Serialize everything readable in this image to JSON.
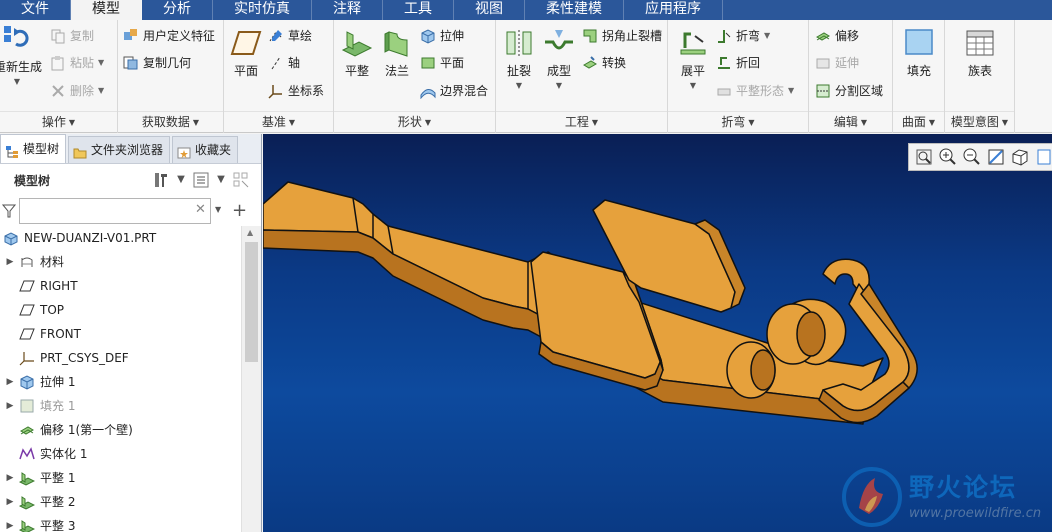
{
  "menu": {
    "tabs": [
      "文件",
      "模型",
      "分析",
      "实时仿真",
      "注释",
      "工具",
      "视图",
      "柔性建模",
      "应用程序"
    ],
    "active": "模型"
  },
  "ribbon": {
    "operations": {
      "regen_label": "重新生成",
      "copy_label": "复制",
      "paste_label": "粘贴",
      "delete_label": "删除",
      "title": "操作"
    },
    "get_data": {
      "udf_label": "用户定义特征",
      "copy_geom_label": "复制几何",
      "title": "获取数据"
    },
    "datum": {
      "plane_label": "平面",
      "sketch_label": "草绘",
      "axis_label": "轴",
      "csys_label": "坐标系",
      "title": "基准"
    },
    "shapes": {
      "flat_label": "平整",
      "flange_label": "法兰",
      "extrude_label": "拉伸",
      "plane_label": "平面",
      "blend_label": "边界混合",
      "title": "形状"
    },
    "engineering": {
      "rip_label": "扯裂",
      "form_label": "成型",
      "corner_relief_label": "拐角止裂槽",
      "convert_label": "转换",
      "title": "工程"
    },
    "bend": {
      "unbend_label": "展平",
      "bend_label": "折弯",
      "bend_back_label": "折回",
      "flat_state_label": "平整形态",
      "title": "折弯"
    },
    "edit": {
      "offset_label": "偏移",
      "extend_label": "延伸",
      "split_label": "分割区域",
      "title": "编辑"
    },
    "surface": {
      "fill_label": "填充",
      "title": "曲面"
    },
    "intent": {
      "family_label": "族表",
      "title": "模型意图"
    }
  },
  "panel": {
    "tabs": [
      "模型树",
      "文件夹浏览器",
      "收藏夹"
    ],
    "active_tab": "模型树",
    "title": "模型树",
    "search": {
      "value": "",
      "placeholder": ""
    },
    "tree": [
      {
        "label": "NEW-DUANZI-V01.PRT",
        "icon": "part-icon",
        "expandable": false,
        "dim": false
      },
      {
        "label": "材料",
        "icon": "material-icon",
        "expandable": true,
        "dim": false
      },
      {
        "label": "RIGHT",
        "icon": "datum-plane-icon",
        "expandable": false,
        "dim": false
      },
      {
        "label": "TOP",
        "icon": "datum-plane-icon",
        "expandable": false,
        "dim": false
      },
      {
        "label": "FRONT",
        "icon": "datum-plane-icon",
        "expandable": false,
        "dim": false
      },
      {
        "label": "PRT_CSYS_DEF",
        "icon": "csys-icon",
        "expandable": false,
        "dim": false
      },
      {
        "label": "拉伸 1",
        "icon": "extrude-icon",
        "expandable": true,
        "dim": false
      },
      {
        "label": "填充 1",
        "icon": "fill-icon",
        "expandable": true,
        "dim": true
      },
      {
        "label": "偏移 1(第一个壁)",
        "icon": "offset-icon",
        "expandable": false,
        "dim": false
      },
      {
        "label": "实体化 1",
        "icon": "solidify-icon",
        "expandable": false,
        "dim": false
      },
      {
        "label": "平整 1",
        "icon": "flat-wall-icon",
        "expandable": true,
        "dim": false
      },
      {
        "label": "平整 2",
        "icon": "flat-wall-icon",
        "expandable": true,
        "dim": false
      },
      {
        "label": "平整 3",
        "icon": "flat-wall-icon",
        "expandable": true,
        "dim": false
      }
    ]
  },
  "watermark": {
    "title": "野火论坛",
    "url": "www.proewildfire.cn"
  },
  "colors": {
    "menu_bg": "#2b579a",
    "model": "#e19b35",
    "viewport_top": "#0a1f55",
    "viewport_bottom": "#0d4a9e"
  }
}
